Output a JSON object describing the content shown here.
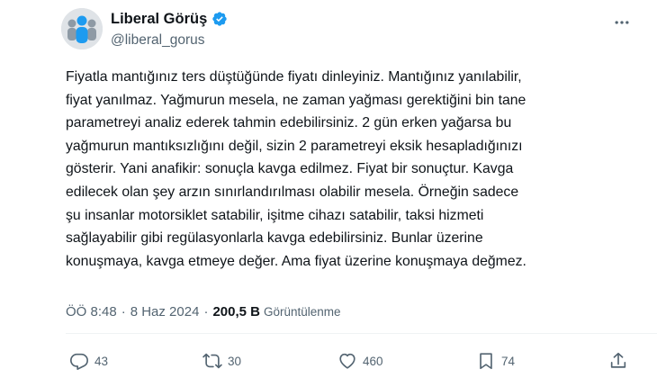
{
  "author": {
    "display_name": "Liberal Görüş",
    "handle": "@liberal_gorus",
    "verified": true
  },
  "tweet": {
    "lines": [
      "Fiyatla mantığınız ters düştüğünde fiyatı dinleyiniz. Mantığınız yanılabilir,",
      "fiyat yanılmaz. Yağmurun mesela, ne zaman yağması gerektiğini bin tane",
      "parametreyi analiz ederek tahmin edebilirsiniz. 2 gün erken yağarsa bu",
      "yağmurun mantıksızlığını değil, sizin 2 parametreyi eksik hesapladığınızı",
      "gösterir. Yani anafikir: sonuçla kavga edilmez. Fiyat bir sonuçtur. Kavga",
      "edilecek olan şey arzın sınırlandırılması olabilir mesela. Örneğin sadece",
      "şu insanlar motorsiklet satabilir, işitme cihazı satabilir, taksi hizmeti",
      "sağlayabilir gibi regülasyonlarla kavga edebilirsiniz. Bunlar üzerine",
      "konuşmaya, kavga etmeye değer. Ama fiyat üzerine konuşmaya değmez."
    ]
  },
  "meta": {
    "time": "ÖÖ 8:48",
    "separator": "·",
    "date": "8 Haz 2024",
    "views_count": "200,5 B",
    "views_label": "Görüntülenme"
  },
  "actions": {
    "replies": "43",
    "retweets": "30",
    "likes": "460",
    "bookmarks": "74"
  },
  "colors": {
    "text": "#0f1419",
    "secondary": "#536471",
    "verified": "#1d9bf0"
  }
}
